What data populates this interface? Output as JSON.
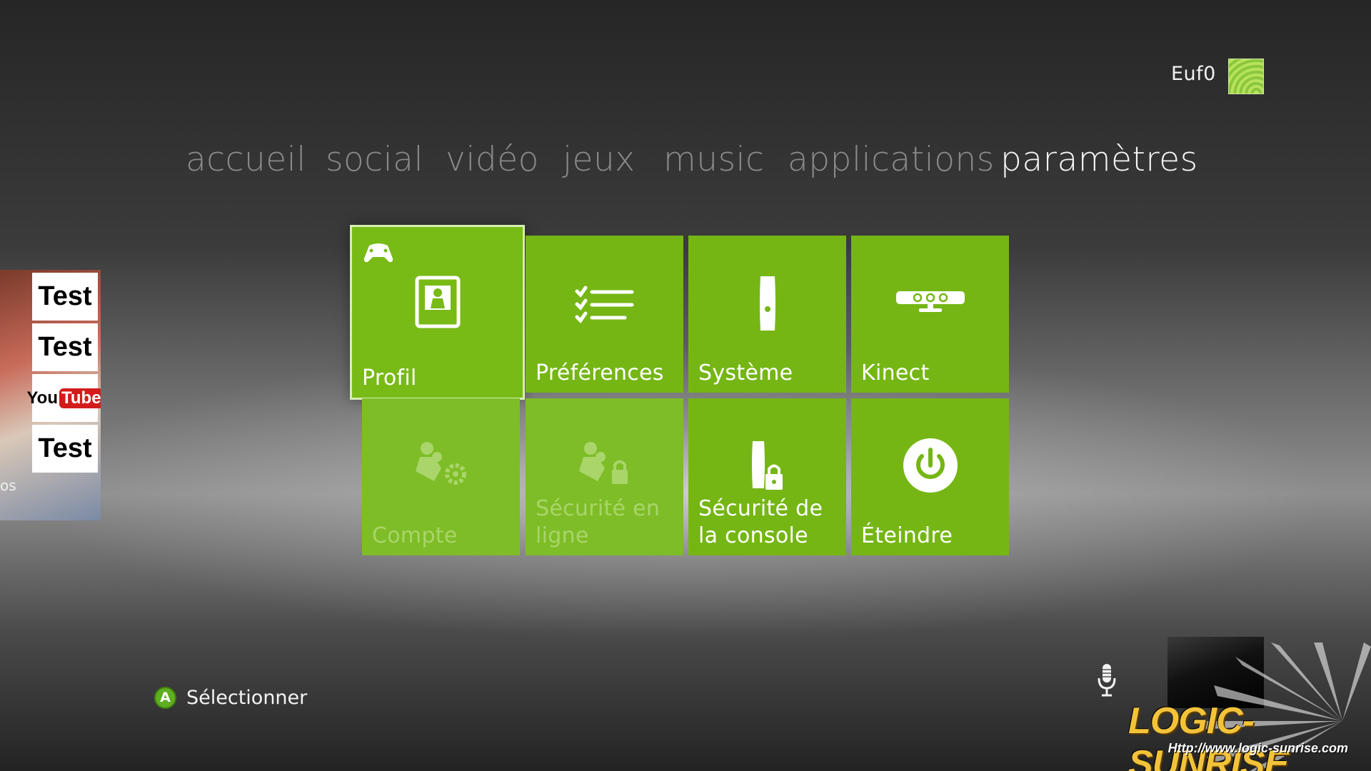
{
  "header": {
    "gamertag": "Euf0",
    "gamerpic_icon": "gamerpic-avatar"
  },
  "nav": {
    "items": [
      {
        "label": "accueil",
        "active": false
      },
      {
        "label": "social",
        "active": false
      },
      {
        "label": "vidéo",
        "active": false
      },
      {
        "label": "jeux",
        "active": false
      },
      {
        "label": "music",
        "active": false
      },
      {
        "label": "applications",
        "active": false
      },
      {
        "label": "paramètres",
        "active": true
      }
    ]
  },
  "tiles": {
    "profil": {
      "label": "Profil",
      "icon": "profile-card-icon",
      "badge_icon": "controller-icon",
      "selected": true
    },
    "preferences": {
      "label": "Préférences",
      "icon": "checklist-icon"
    },
    "systeme": {
      "label": "Système",
      "icon": "console-icon"
    },
    "kinect": {
      "label": "Kinect",
      "icon": "kinect-sensor-icon"
    },
    "compte": {
      "label": "Compte",
      "icon": "account-settings-icon",
      "disabled": true
    },
    "securite_en_ligne": {
      "label_line1": "Sécurité en",
      "label_line2": "ligne",
      "icon": "family-lock-icon",
      "disabled": true
    },
    "securite_console": {
      "label_line1": "Sécurité de",
      "label_line2": "la console",
      "icon": "console-lock-icon"
    },
    "eteindre": {
      "label": "Éteindre",
      "icon": "power-icon"
    }
  },
  "peek": {
    "cards": [
      "Test",
      "Test",
      "Test"
    ],
    "youtube_you": "You",
    "youtube_tube": "Tube",
    "partial_text": "os"
  },
  "footer": {
    "button_letter": "A",
    "hint_label": "Sélectionner",
    "mic_icon": "microphone-icon"
  },
  "watermark": {
    "title": "LOGIC-SUNRISE",
    "url": "Http://www.logic-sunrise.com"
  },
  "colors": {
    "tile_green": "#75b615",
    "button_a_green": "#5fae1f",
    "nav_inactive": "#8a8a8a",
    "nav_active": "#f7f7f7"
  }
}
